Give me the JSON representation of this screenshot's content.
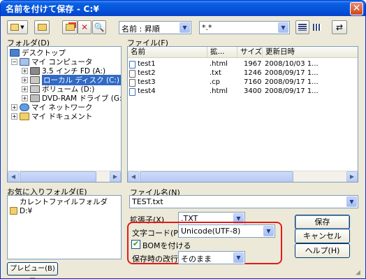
{
  "title": "名前を付けて保存 - C:¥",
  "toolbar": {
    "sort_combo": "名前 : 昇順",
    "filter_combo": "*.*"
  },
  "folder_label": "フォルダ(D)",
  "file_label": "ファイル(F)",
  "tree": [
    {
      "label": "デスクトップ",
      "icon": "desktop-icon",
      "expander": "",
      "selected": false
    },
    {
      "label": "マイ コンピュータ",
      "icon": "my-computer-icon",
      "expander": "−",
      "selected": false
    },
    {
      "label": "3.5 インチ FD (A:)",
      "icon": "floppy-icon",
      "expander": "+",
      "selected": false
    },
    {
      "label": "ローカル ディスク (C:)",
      "icon": "hard-disk-icon",
      "expander": "+",
      "selected": true
    },
    {
      "label": "ボリューム (D:)",
      "icon": "hard-disk-icon",
      "expander": "+",
      "selected": false
    },
    {
      "label": "DVD-RAM ドライブ (G:)",
      "icon": "dvd-drive-icon",
      "expander": "+",
      "selected": false
    },
    {
      "label": "マイ ネットワーク",
      "icon": "network-icon",
      "expander": "+",
      "selected": false
    },
    {
      "label": "マイ ドキュメント",
      "icon": "folder-icon",
      "expander": "+",
      "selected": false
    }
  ],
  "file_columns": [
    "名前",
    "拡...",
    "サイズ",
    "更新日時"
  ],
  "files": [
    {
      "name": "test1",
      "ext": ".html",
      "size": "1967",
      "date": "2008/10/03 1...",
      "icon": "html-file-icon"
    },
    {
      "name": "test2",
      "ext": ".txt",
      "size": "1246",
      "date": "2008/09/17 1...",
      "icon": "text-file-icon"
    },
    {
      "name": "test3",
      "ext": ".cp",
      "size": "7160",
      "date": "2008/09/17 1...",
      "icon": "text-file-icon"
    },
    {
      "name": "test4",
      "ext": ".html",
      "size": "3400",
      "date": "2008/09/17 1...",
      "icon": "html-file-icon"
    }
  ],
  "favorites_label": "お気に入りフォルダ(E)",
  "favorites": [
    {
      "label": "カレントファイルフォルダ",
      "icon": "folder-icon"
    },
    {
      "label": "D:¥",
      "icon": "folder-icon"
    }
  ],
  "filename_label": "ファイル名(N)",
  "filename_value": "TEST.txt",
  "extension_label": "拡張子(X)",
  "extension_value": ".TXT",
  "encoding_label": "文字コード(P)",
  "encoding_value": "Unicode(UTF-8)",
  "bom_label": "BOMを付ける",
  "bom_checked": "✔",
  "newline_label": "保存時の改行",
  "newline_value": "そのまま",
  "buttons": {
    "save": "保存",
    "cancel": "キャンセル",
    "help": "ヘルプ(H)",
    "preview": "プレビュー(B) ▼"
  },
  "colors": {
    "titlebar": "#0653da",
    "dialog_bg": "#ece9d8",
    "selection": "#316ac5",
    "highlight_box": "#e21a1a"
  }
}
